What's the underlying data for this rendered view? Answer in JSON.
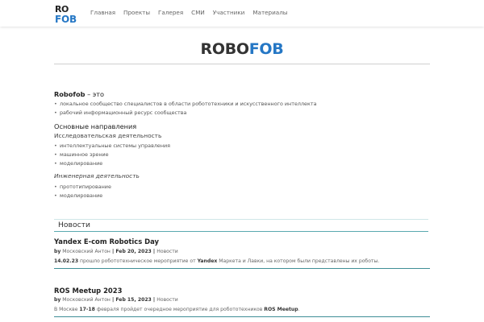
{
  "header": {
    "logo_text": "ROFOB",
    "nav": [
      "Главная",
      "Проекты",
      "Галерея",
      "СМИ",
      "Участники",
      "Материалы"
    ]
  },
  "title": {
    "part1": "ROBO",
    "part2": "FOB"
  },
  "about": {
    "heading_bold": "Robofob",
    "heading_rest": " – это",
    "items": [
      "локальное сообщество специалистов в области робототехники и искусственного интеллекта",
      "рабочий информационный ресурс сообщества"
    ]
  },
  "directions": {
    "heading": "Основные направления",
    "research_heading": "Исследовательская деятельность",
    "research_items": [
      "интеллектуальные системы управления",
      "машинное зрение",
      "моделирование"
    ],
    "engineering_heading": "Инженерная деятельность",
    "engineering_items": [
      "прототипирование",
      "моделирование"
    ]
  },
  "news": {
    "heading": "Новости",
    "posts": [
      {
        "title": "Yandex E-com Robotics Day",
        "by": "by",
        "author": "Московский Антон",
        "sep1": " | ",
        "date": "Feb 20, 2023",
        "sep2": " | ",
        "category": "Новости",
        "text_lead": "14.02.23",
        "text_1": " прошло робототехническое мероприятие от ",
        "text_bold": "Yandex",
        "text_2": " Маркета и Лавки, на котором были представлены их роботы."
      },
      {
        "title": "ROS Meetup 2023",
        "by": "by",
        "author": "Московский Антон",
        "sep1": " | ",
        "date": "Feb 15, 2023",
        "sep2": " | ",
        "category": "Новости",
        "text_1a": "В Москве ",
        "text_bold1": "17-18",
        "text_1": " февраля пройдет очередное мероприятие для робототехников ",
        "text_bold": "ROS Meetup",
        "text_2": "."
      }
    ]
  },
  "colors": {
    "accent": "#2577c5",
    "rule": "#3f8e96"
  }
}
